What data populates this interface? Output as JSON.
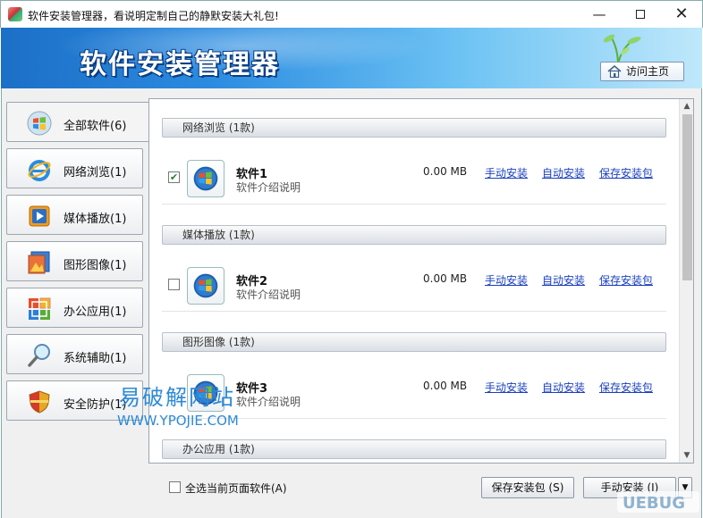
{
  "window": {
    "title": "软件安装管理器，看说明定制自己的静默安装大礼包!",
    "minimize": "—",
    "close": "✕"
  },
  "banner": {
    "title": "软件安装管理器",
    "visit_button": "访问主页"
  },
  "sidebar": {
    "items": [
      {
        "label": "全部软件(6)",
        "icon": "windows-orb-icon",
        "active": true
      },
      {
        "label": "网络浏览(1)",
        "icon": "ie-icon"
      },
      {
        "label": "媒体播放(1)",
        "icon": "media-player-icon"
      },
      {
        "label": "图形图像(1)",
        "icon": "image-icon"
      },
      {
        "label": "办公应用(1)",
        "icon": "office-icon"
      },
      {
        "label": "系统辅助(1)",
        "icon": "magnifier-icon"
      },
      {
        "label": "安全防护(1)",
        "icon": "shield-icon"
      }
    ]
  },
  "categories": [
    {
      "header": "网络浏览 (1款)",
      "software": {
        "name": "软件1",
        "desc": "软件介绍说明",
        "size": "0.00 MB",
        "checked": true
      }
    },
    {
      "header": "媒体播放 (1款)",
      "software": {
        "name": "软件2",
        "desc": "软件介绍说明",
        "size": "0.00 MB",
        "checked": false
      }
    },
    {
      "header": "图形图像 (1款)",
      "software": {
        "name": "软件3",
        "desc": "软件介绍说明",
        "size": "0.00 MB",
        "checked": false
      }
    },
    {
      "header": "办公应用 (1款)"
    }
  ],
  "row_links": {
    "manual": "手动安装",
    "auto": "自动安装",
    "save": "保存安装包"
  },
  "footer": {
    "select_all": "全选当前页面软件(A)",
    "save_button": "保存安装包 (S)",
    "manual_button": "手动安装 (I)",
    "dropdown": "▼"
  },
  "watermark": {
    "cn": "易破解网站",
    "en": "WWW.YPOJIE.COM"
  },
  "colors": {
    "link": "#1a3fbf",
    "banner_start": "#1c6fc6",
    "banner_end": "#bfe8fb"
  }
}
